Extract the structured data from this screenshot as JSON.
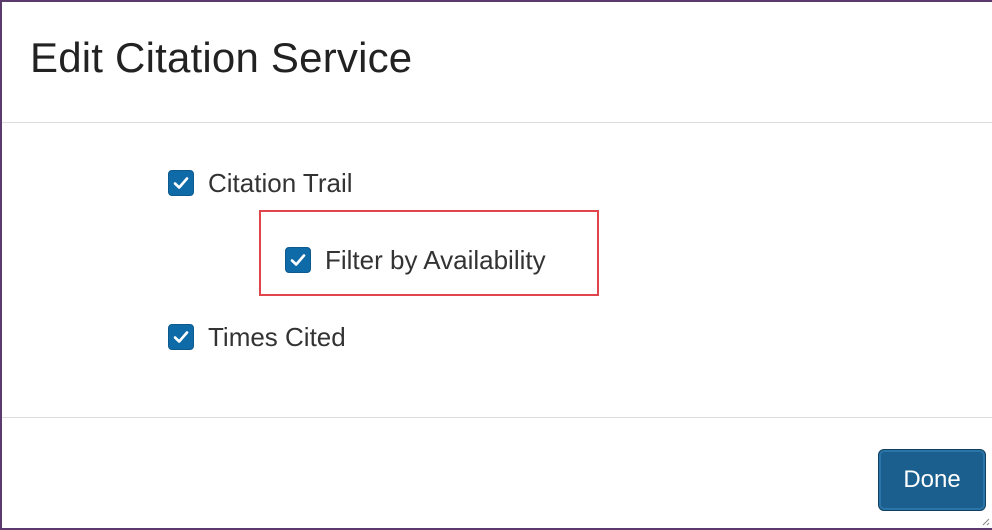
{
  "dialog": {
    "title": "Edit Citation Service"
  },
  "options": {
    "citation_trail": {
      "label": "Citation Trail",
      "checked": true
    },
    "filter_by_availability": {
      "label": "Filter by Availability",
      "checked": true
    },
    "times_cited": {
      "label": "Times Cited",
      "checked": true
    }
  },
  "footer": {
    "done_label": "Done"
  },
  "colors": {
    "checkbox": "#0f6aa8",
    "highlight": "#e0454b",
    "primary_button": "#1b5f8e",
    "dialog_border": "#5b3b6e"
  }
}
